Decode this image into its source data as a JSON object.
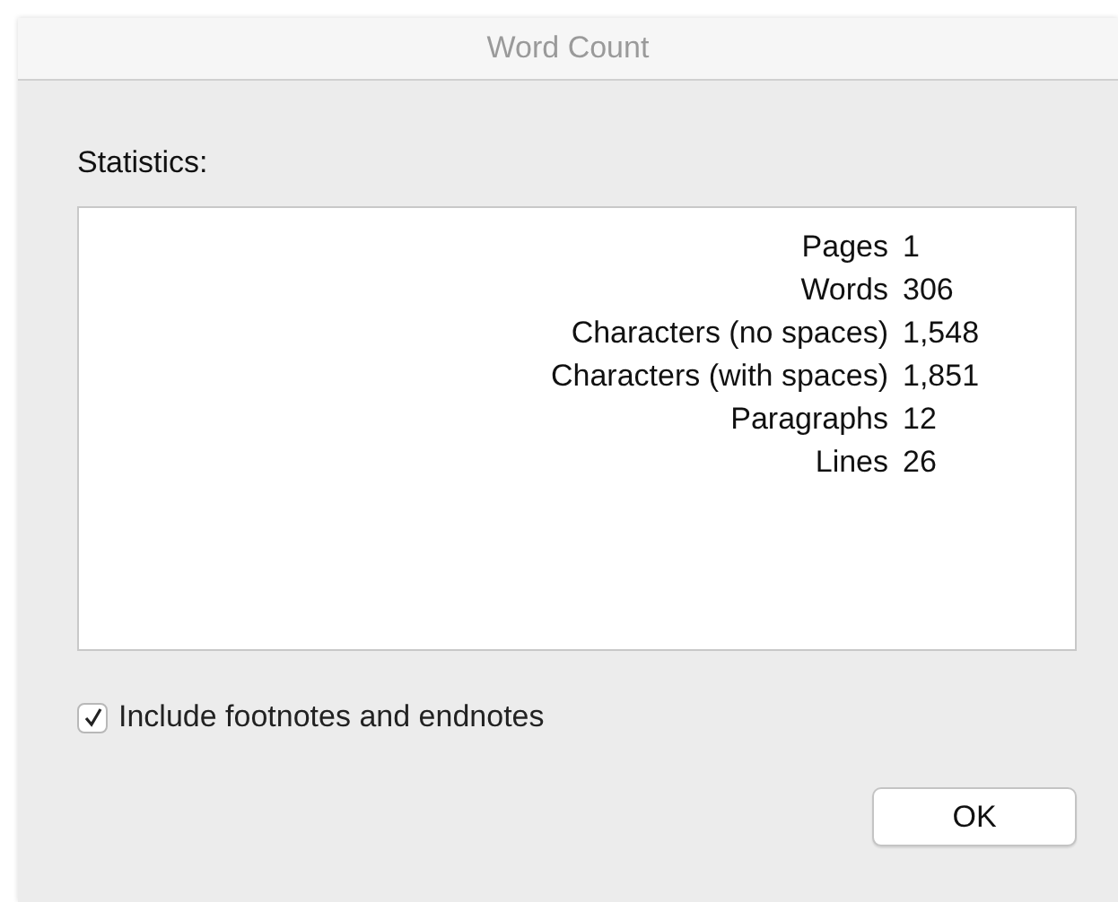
{
  "window": {
    "title": "Word Count"
  },
  "statistics": {
    "label": "Statistics:",
    "rows": [
      {
        "name": "Pages",
        "value": "1"
      },
      {
        "name": "Words",
        "value": "306"
      },
      {
        "name": "Characters (no spaces)",
        "value": "1,548"
      },
      {
        "name": "Characters (with spaces)",
        "value": "1,851"
      },
      {
        "name": "Paragraphs",
        "value": "12"
      },
      {
        "name": "Lines",
        "value": "26"
      }
    ]
  },
  "include_notes": {
    "label": "Include footnotes and endnotes",
    "checked": true
  },
  "buttons": [
    "OK"
  ]
}
